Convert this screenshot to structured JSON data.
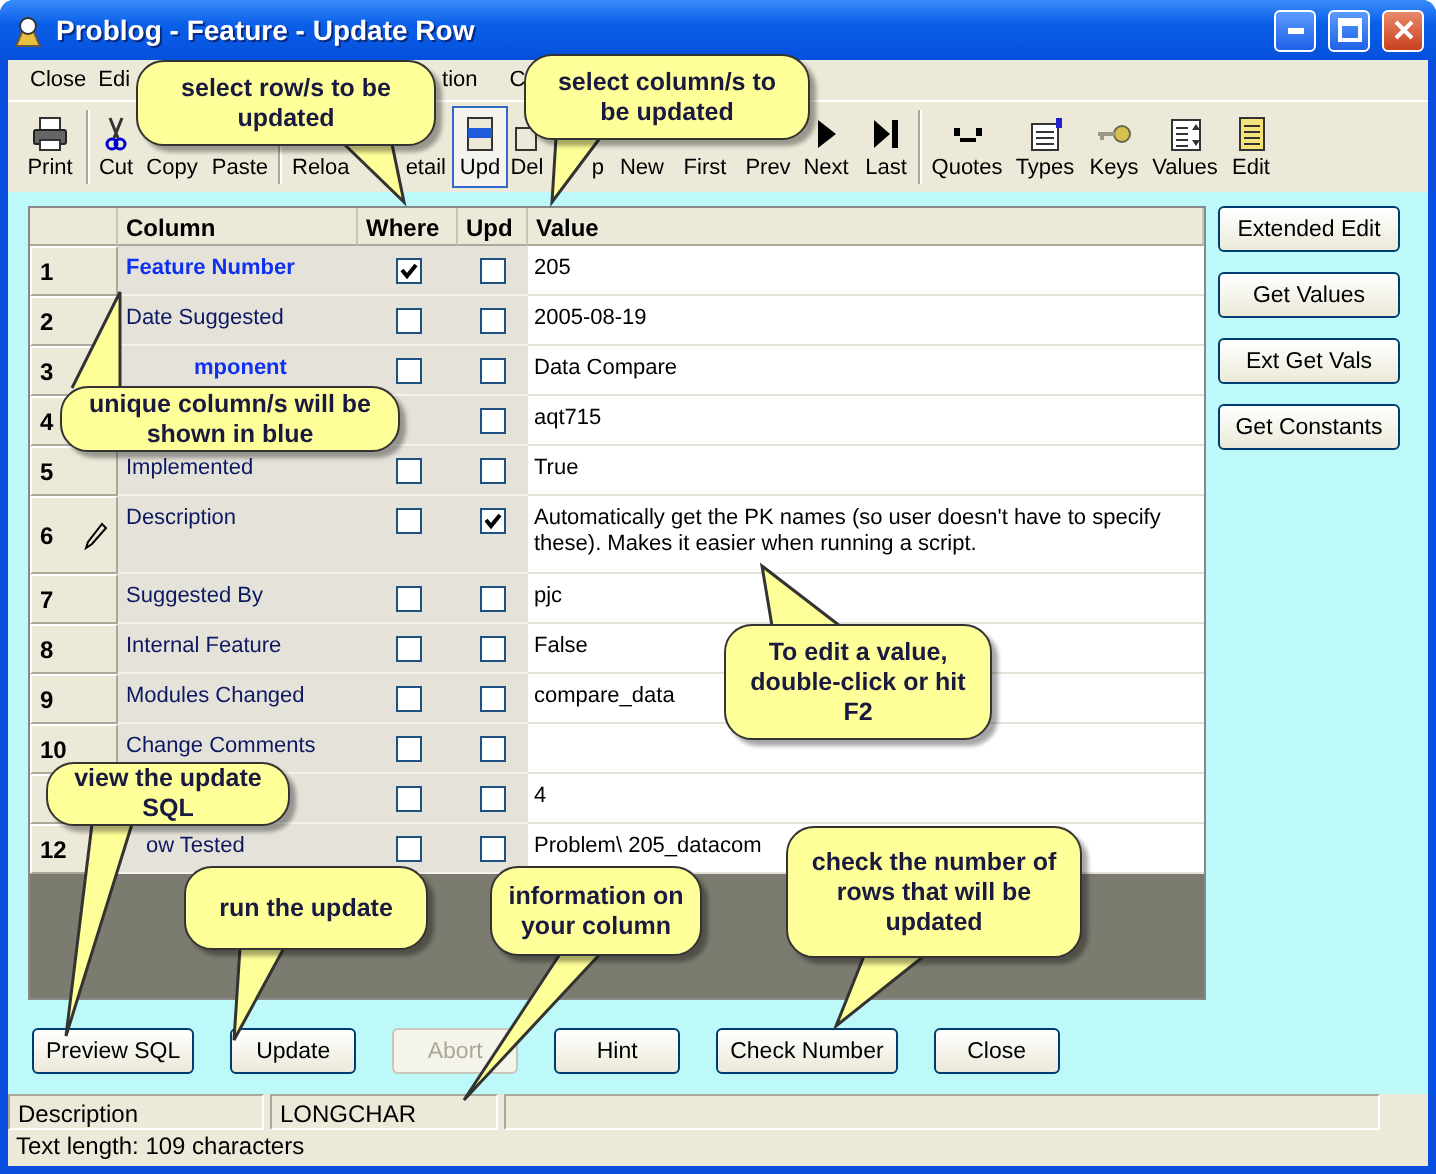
{
  "window": {
    "title": "Problog - Feature - Update Row"
  },
  "menu": [
    {
      "label": "Close"
    },
    {
      "label": "Edi"
    },
    {
      "label": "tion"
    },
    {
      "label": "C"
    }
  ],
  "toolbar": [
    {
      "label": "Print",
      "selected": false
    },
    {
      "label": "Cut",
      "selected": false
    },
    {
      "label": "Copy",
      "selected": false
    },
    {
      "label": "Paste",
      "selected": false
    },
    {
      "label": "Reloa",
      "selected": false
    },
    {
      "label": "etail",
      "selected": false
    },
    {
      "label": "Upd",
      "selected": true
    },
    {
      "label": "Del",
      "selected": false
    },
    {
      "label": "p",
      "selected": false
    },
    {
      "label": "New",
      "selected": false
    },
    {
      "label": "First",
      "selected": false
    },
    {
      "label": "Prev",
      "selected": false
    },
    {
      "label": "Next",
      "selected": false
    },
    {
      "label": "Last",
      "selected": false
    },
    {
      "label": "Quotes",
      "selected": false
    },
    {
      "label": "Types",
      "selected": false
    },
    {
      "label": "Keys",
      "selected": false
    },
    {
      "label": "Values",
      "selected": false
    },
    {
      "label": "Edit",
      "selected": false
    }
  ],
  "grid": {
    "columns": [
      "Column",
      "Where",
      "Upd",
      "Value"
    ],
    "rows": [
      {
        "number": "1",
        "column": "Feature Number",
        "unique": true,
        "where": true,
        "upd": false,
        "value": "205",
        "editing": false
      },
      {
        "number": "2",
        "column": "Date Suggested",
        "unique": false,
        "where": false,
        "upd": false,
        "value": "2005-08-19",
        "editing": false
      },
      {
        "number": "3",
        "column": "mponent",
        "unique": true,
        "where": false,
        "upd": false,
        "value": "Data Compare",
        "editing": false
      },
      {
        "number": "4",
        "upd": false,
        "value": "aqt715",
        "editing": false
      },
      {
        "number": "5",
        "column": "Implemented",
        "unique": false,
        "where": false,
        "upd": false,
        "value": "True",
        "editing": false
      },
      {
        "number": "6",
        "column": "Description",
        "unique": false,
        "where": false,
        "upd": true,
        "value": "Automatically get the PK names (so user doesn't have to specify these). Makes it easier when running a script.",
        "editing": true
      },
      {
        "number": "7",
        "column": "Suggested By",
        "unique": false,
        "where": false,
        "upd": false,
        "value": "pjc",
        "editing": false
      },
      {
        "number": "8",
        "column": "Internal Feature",
        "unique": false,
        "where": false,
        "upd": false,
        "value": "False",
        "editing": false
      },
      {
        "number": "9",
        "column": "Modules Changed",
        "unique": false,
        "where": false,
        "upd": false,
        "value": "compare_data",
        "editing": false
      },
      {
        "number": "10",
        "column": "Change Comments",
        "unique": false,
        "where": false,
        "upd": false,
        "editing": false
      },
      {
        "where": false,
        "upd": false,
        "value": "4"
      },
      {
        "number": "12",
        "column": "ow Tested",
        "unique": false,
        "where": false,
        "upd": false,
        "value": "Problem\\ 205_datacom",
        "editing": false
      }
    ]
  },
  "side_buttons": [
    "Extended Edit",
    "Get Values",
    "Ext Get Vals",
    "Get Constants"
  ],
  "buttons": [
    {
      "label": "Preview SQL",
      "disabled": false
    },
    {
      "label": "Update",
      "disabled": false
    },
    {
      "label": "Abort",
      "disabled": true
    },
    {
      "label": "Hint",
      "disabled": false
    },
    {
      "label": "Check Number",
      "disabled": false
    },
    {
      "label": "Close",
      "disabled": false
    }
  ],
  "status": {
    "panels": [
      "Description",
      "LONGCHAR"
    ],
    "text": "Text length: 109 characters"
  },
  "callouts": [
    {
      "text": "select row/s to be updated"
    },
    {
      "text": "select column/s to be updated"
    },
    {
      "text": "unique column/s will be shown in blue"
    },
    {
      "text": "To edit a value, double-click or hit F2"
    },
    {
      "text": "view the update SQL"
    },
    {
      "text": "run the update"
    },
    {
      "text": "information on your column"
    },
    {
      "text": "check the number of rows that will be updated"
    }
  ]
}
